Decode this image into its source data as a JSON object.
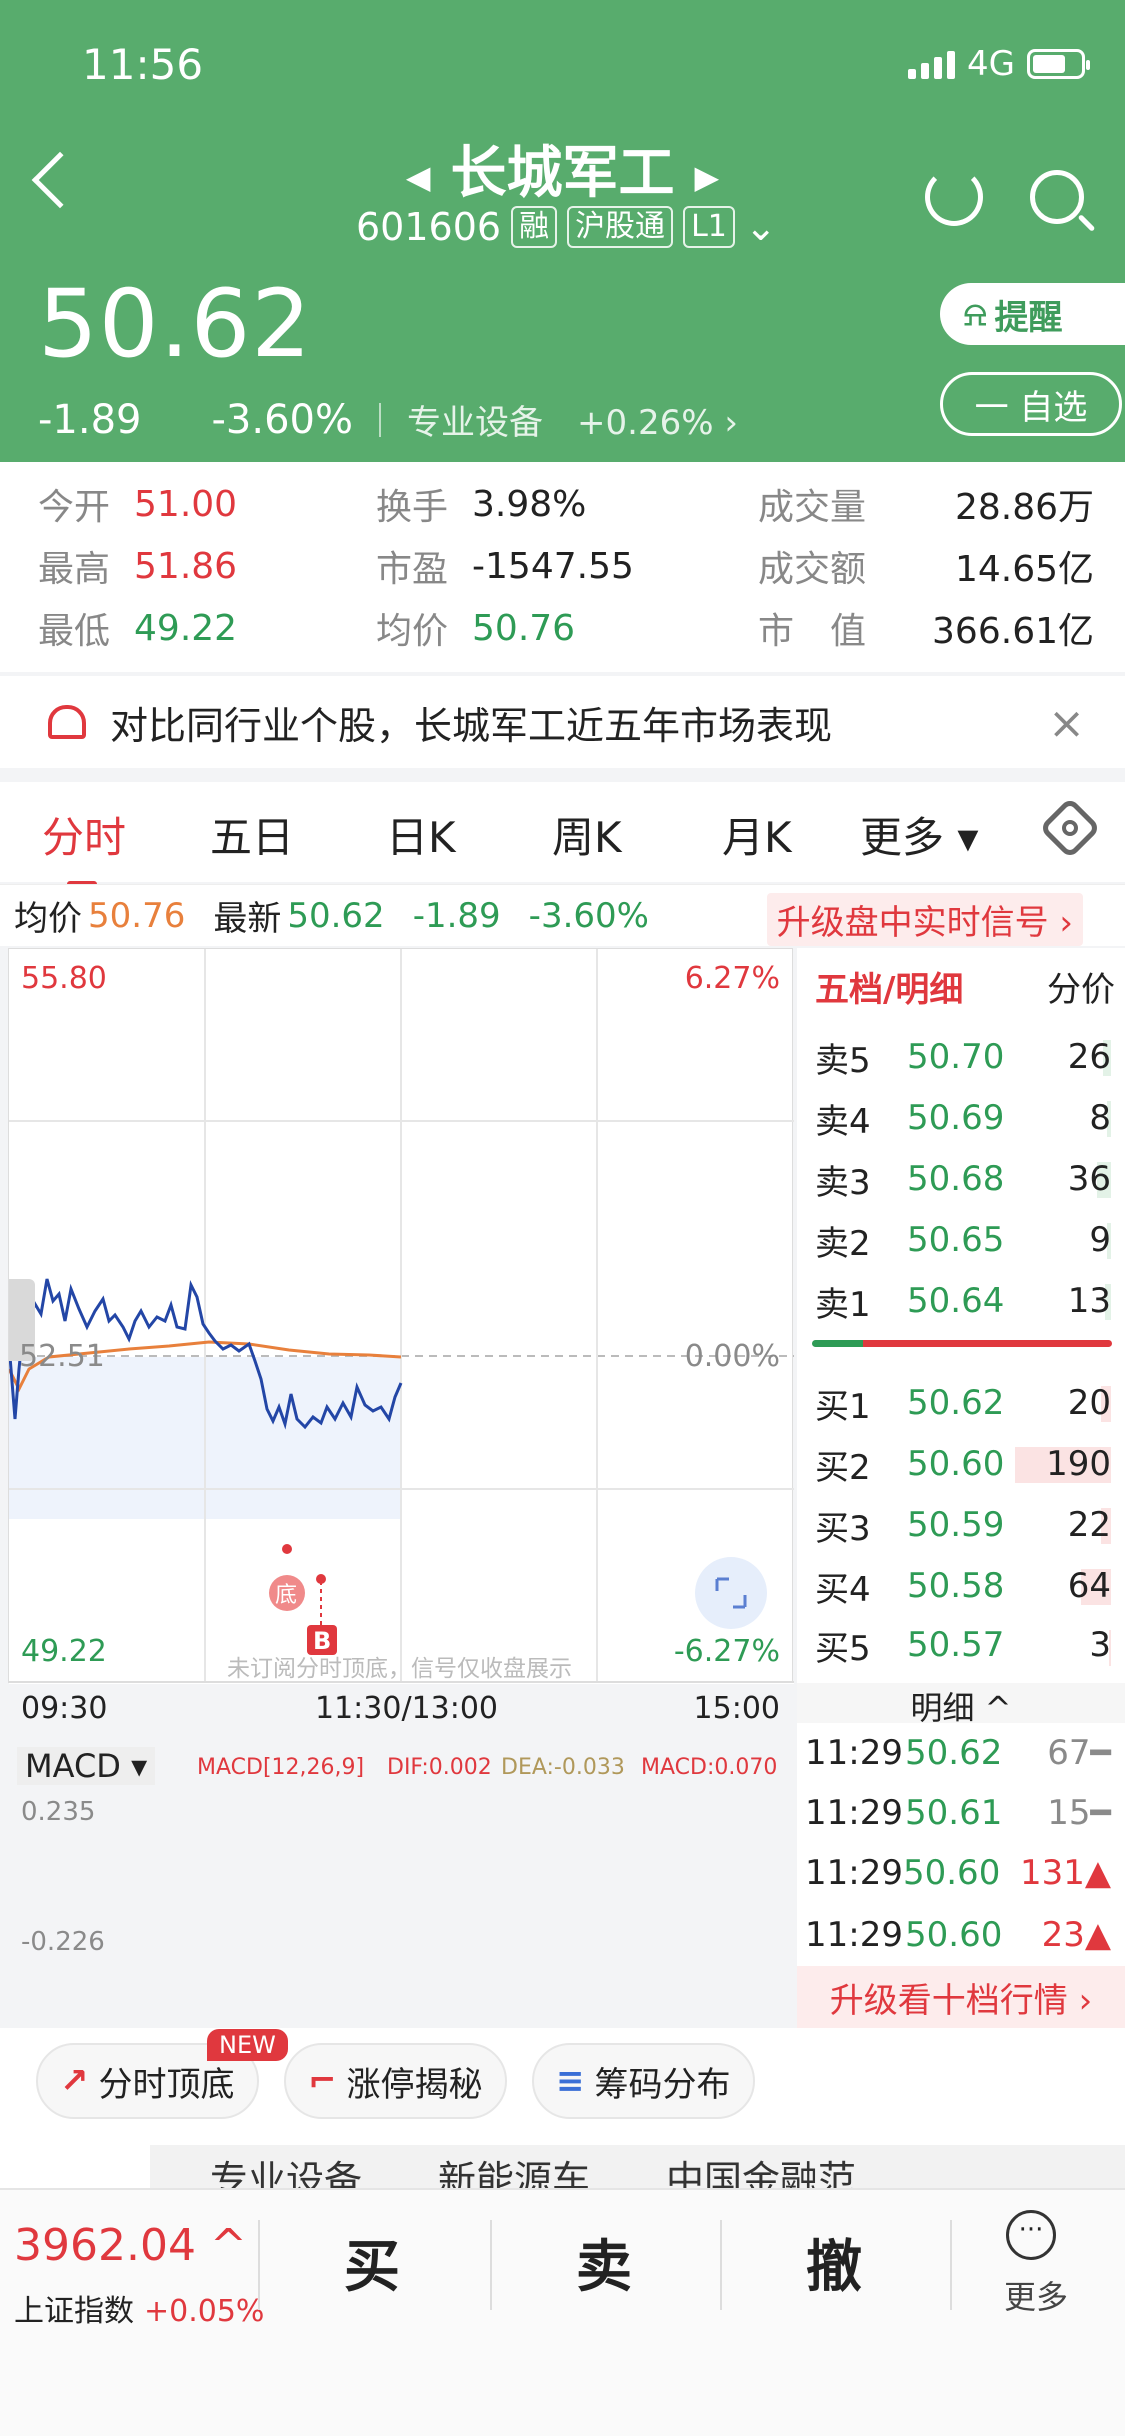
{
  "status": {
    "time": "11:56",
    "network": "4G"
  },
  "header": {
    "name": "长城军工",
    "code": "601606",
    "tags": [
      "融",
      "沪股通",
      "L1"
    ],
    "price": "50.62",
    "change": "-1.89",
    "change_pct": "-3.60%",
    "sector": "专业设备",
    "sector_pct": "+0.26%",
    "remind_label": "提醒",
    "watch_label": "一 自选"
  },
  "stats": {
    "open_label": "今开",
    "open": "51.00",
    "high_label": "最高",
    "high": "51.86",
    "low_label": "最低",
    "low": "49.22",
    "turnover_label": "换手",
    "turnover": "3.98%",
    "pe_label": "市盈",
    "pe": "-1547.55",
    "avg_label": "均价",
    "avg": "50.76",
    "volume_label": "成交量",
    "volume": "28.86万",
    "amount_label": "成交额",
    "amount": "14.65亿",
    "mcap_label": "市　值",
    "mcap": "366.61亿"
  },
  "promo": {
    "text": "对比同行业个股，长城军工近五年市场表现",
    "close": "×"
  },
  "tabs": [
    "分时",
    "五日",
    "日K",
    "周K",
    "月K",
    "更多 ▾"
  ],
  "inforow": {
    "avg_label": "均价",
    "avg": "50.76",
    "last_label": "最新",
    "last": "50.62",
    "chg": "-1.89",
    "pct": "-3.60%",
    "upgrade": "升级盘中实时信号 ›"
  },
  "chart": {
    "y_top": "55.80",
    "y_top_pct": "6.27%",
    "y_mid": "52.51",
    "y_mid_pct": "0.00%",
    "y_bottom": "49.22",
    "y_bottom_pct": "-6.27%",
    "watermark": "未订阅分时顶底，信号仅收盘展示",
    "signal_bottom": "底",
    "signal_buy": "B",
    "time_start": "09:30",
    "time_mid": "11:30/13:00",
    "time_end": "15:00",
    "macd_label": "MACD ▾",
    "macd_params": "MACD[12,26,9]",
    "dif": "DIF:0.002",
    "dea": "DEA:-0.033",
    "macd": "MACD:0.070",
    "macd_top": "0.235",
    "macd_bottom": "-0.226",
    "colors": {
      "price": "#2346a6",
      "avg": "#e8803c",
      "up": "#e0383e",
      "down": "#3f9c3f"
    }
  },
  "book": {
    "title": "五档/明细",
    "tab2": "分价",
    "asks": [
      {
        "name": "卖5",
        "price": "50.70",
        "vol": "26"
      },
      {
        "name": "卖4",
        "price": "50.69",
        "vol": "8"
      },
      {
        "name": "卖3",
        "price": "50.68",
        "vol": "36"
      },
      {
        "name": "卖2",
        "price": "50.65",
        "vol": "9"
      },
      {
        "name": "卖1",
        "price": "50.64",
        "vol": "13"
      }
    ],
    "bids": [
      {
        "name": "买1",
        "price": "50.62",
        "vol": "20"
      },
      {
        "name": "买2",
        "price": "50.60",
        "vol": "190"
      },
      {
        "name": "买3",
        "price": "50.59",
        "vol": "22"
      },
      {
        "name": "买4",
        "price": "50.58",
        "vol": "64"
      },
      {
        "name": "买5",
        "price": "50.57",
        "vol": "3"
      }
    ],
    "detail_label": "明细 ^",
    "trades": [
      {
        "time": "11:29",
        "price": "50.62",
        "vol": "67━",
        "dir": "flat"
      },
      {
        "time": "11:29",
        "price": "50.61",
        "vol": "15━",
        "dir": "flat"
      },
      {
        "time": "11:29",
        "price": "50.60",
        "vol": "131▲",
        "dir": "up"
      },
      {
        "time": "11:29",
        "price": "50.60",
        "vol": "23▲",
        "dir": "up"
      }
    ],
    "upgrade10": "升级看十档行情 ›"
  },
  "chips": [
    {
      "icon": "↗",
      "label": "分时顶底"
    },
    {
      "icon": "⌐",
      "label": "涨停揭秘"
    },
    {
      "icon": "≡",
      "label": "筹码分布"
    }
  ],
  "new_badge": "NEW",
  "cutoff_text": "专业设备　　新能源车　　中国金融范",
  "bottom": {
    "index_value": "3962.04 ^",
    "index_name": "上证指数",
    "index_pct": "+0.05%",
    "buy": "买",
    "sell": "卖",
    "cancel": "撤",
    "more_icon": "···",
    "more": "更多"
  }
}
